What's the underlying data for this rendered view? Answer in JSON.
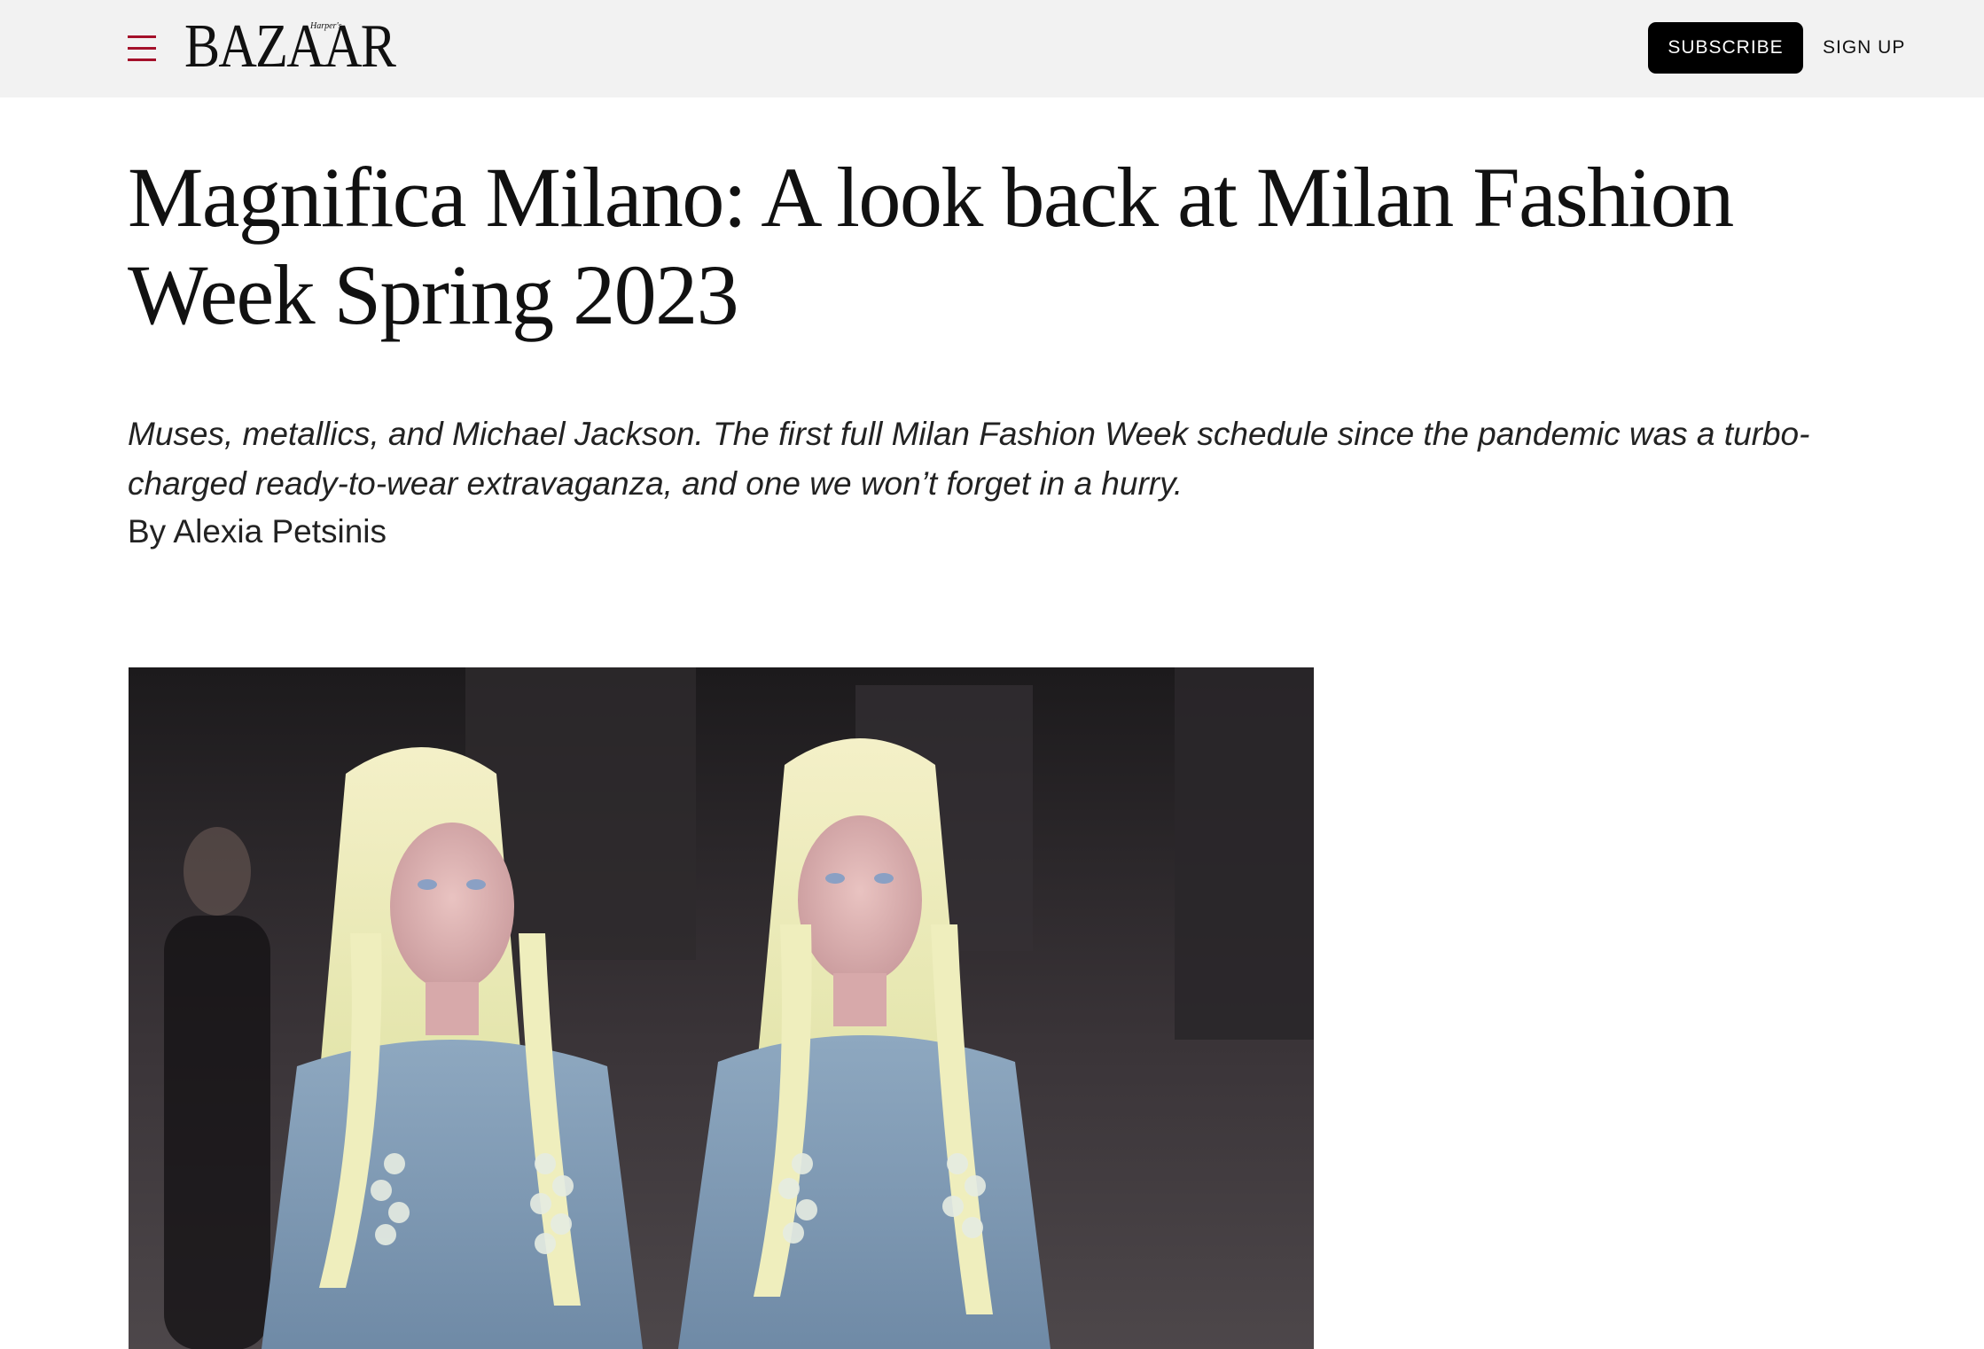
{
  "header": {
    "menu_icon": "hamburger-menu-icon",
    "logo_text": "BAZAAR",
    "logo_superscript": "Harper's",
    "subscribe_label": "SUBSCRIBE",
    "signup_label": "SIGN UP"
  },
  "article": {
    "title": "Magnifica Milano: A look back at Milan Fashion Week Spring 2023",
    "dek": "Muses, metallics, and Michael Jackson. The first full Milan Fashion Week schedule since the pandemic was a turbo-charged ready-to-wear extravaganza, and one we won’t forget in a hurry.",
    "byline": "By Alexia Petsinis"
  },
  "colors": {
    "topbar_bg": "#f2f2f2",
    "menu_accent": "#a4102a",
    "subscribe_bg": "#000000",
    "subscribe_text": "#ffffff"
  }
}
